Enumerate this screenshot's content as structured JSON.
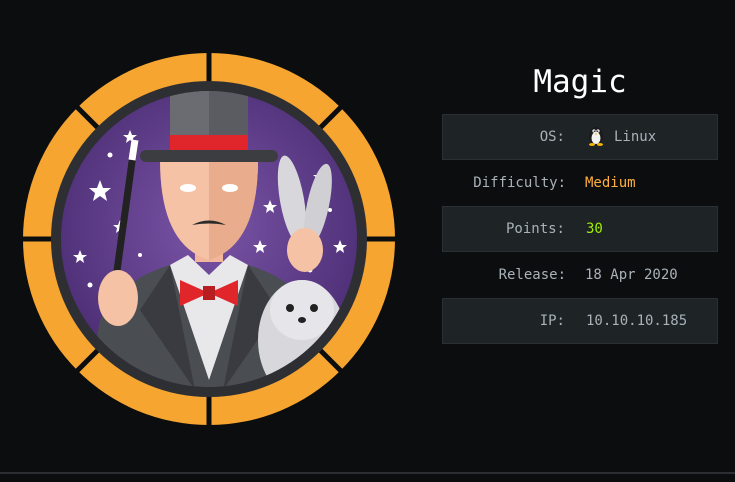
{
  "machine": {
    "name": "Magic",
    "os_label": "OS:",
    "os_value": "Linux",
    "os_icon": "tux-penguin-icon",
    "difficulty_label": "Difficulty:",
    "difficulty_value": "Medium",
    "points_label": "Points:",
    "points_value": "30",
    "release_label": "Release:",
    "release_value": "18 Apr 2020",
    "ip_label": "IP:",
    "ip_value": "10.10.10.185"
  },
  "colors": {
    "background": "#0c0d0f",
    "row_shade": "#1e2326",
    "label_text": "#a9b2b9",
    "difficulty_medium": "#ffaf40",
    "points_green": "#9fef00",
    "badge_ring": "#f7a531",
    "badge_inner": "#5c3a86"
  }
}
